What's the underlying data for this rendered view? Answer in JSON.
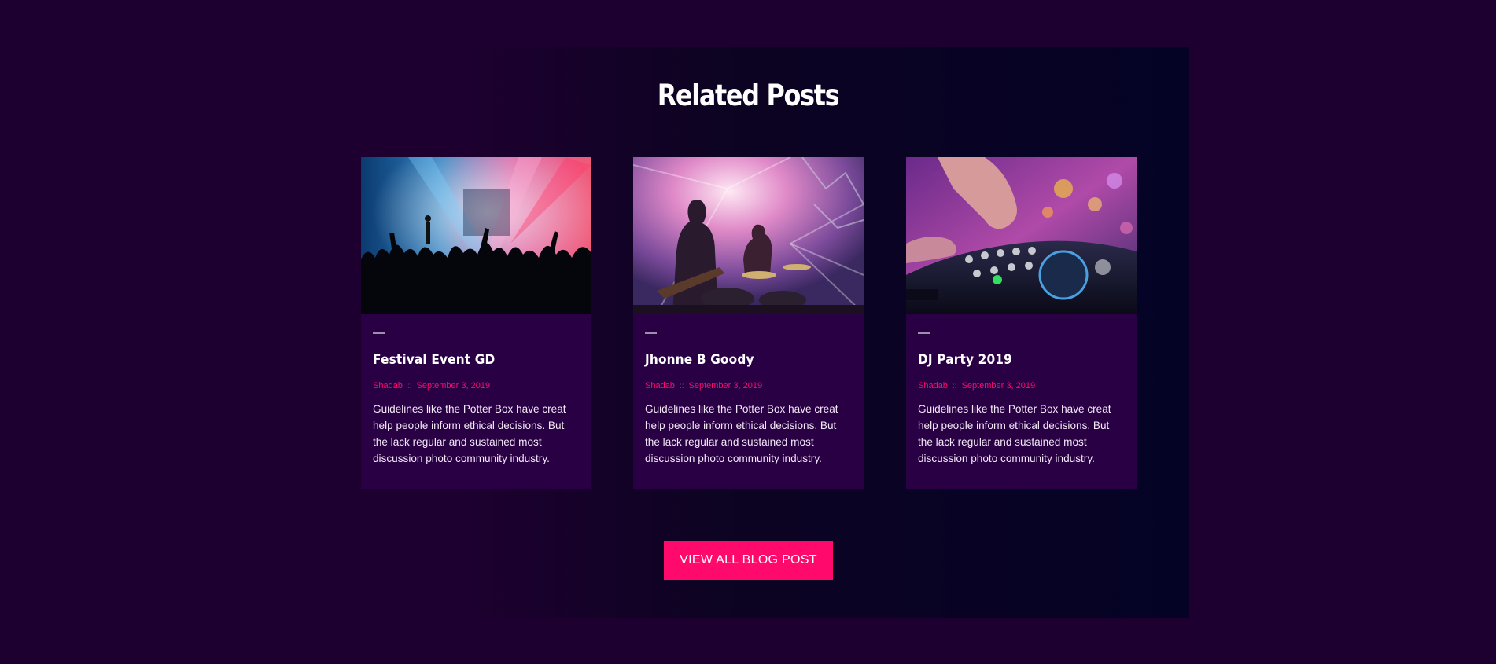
{
  "section": {
    "title": "Related Posts"
  },
  "posts": [
    {
      "title": "Festival Event GD",
      "author": "Shadab",
      "separator": "::",
      "date": "September 3, 2019",
      "excerpt": "Guidelines like the Potter Box have creat help people inform ethical decisions. But the lack regular and sustained most discussion photo community industry.",
      "image": "concert-crowd-photo"
    },
    {
      "title": "Jhonne B Goody",
      "author": "Shadab",
      "separator": "::",
      "date": "September 3, 2019",
      "excerpt": "Guidelines like the Potter Box have creat help people inform ethical decisions. But the lack regular and sustained most discussion photo community industry.",
      "image": "band-on-stage-photo"
    },
    {
      "title": "DJ Party 2019",
      "author": "Shadab",
      "separator": "::",
      "date": "September 3, 2019",
      "excerpt": "Guidelines like the Potter Box have creat help people inform ethical decisions. But the lack regular and sustained most discussion photo community industry.",
      "image": "dj-mixer-photo"
    }
  ],
  "cta": {
    "label": "VIEW ALL BLOG POST"
  },
  "colors": {
    "background": "#1e0030",
    "card": "#2a0045",
    "accent": "#ff0a6c",
    "title": "#ffffff",
    "text": "#f1e8f5"
  }
}
